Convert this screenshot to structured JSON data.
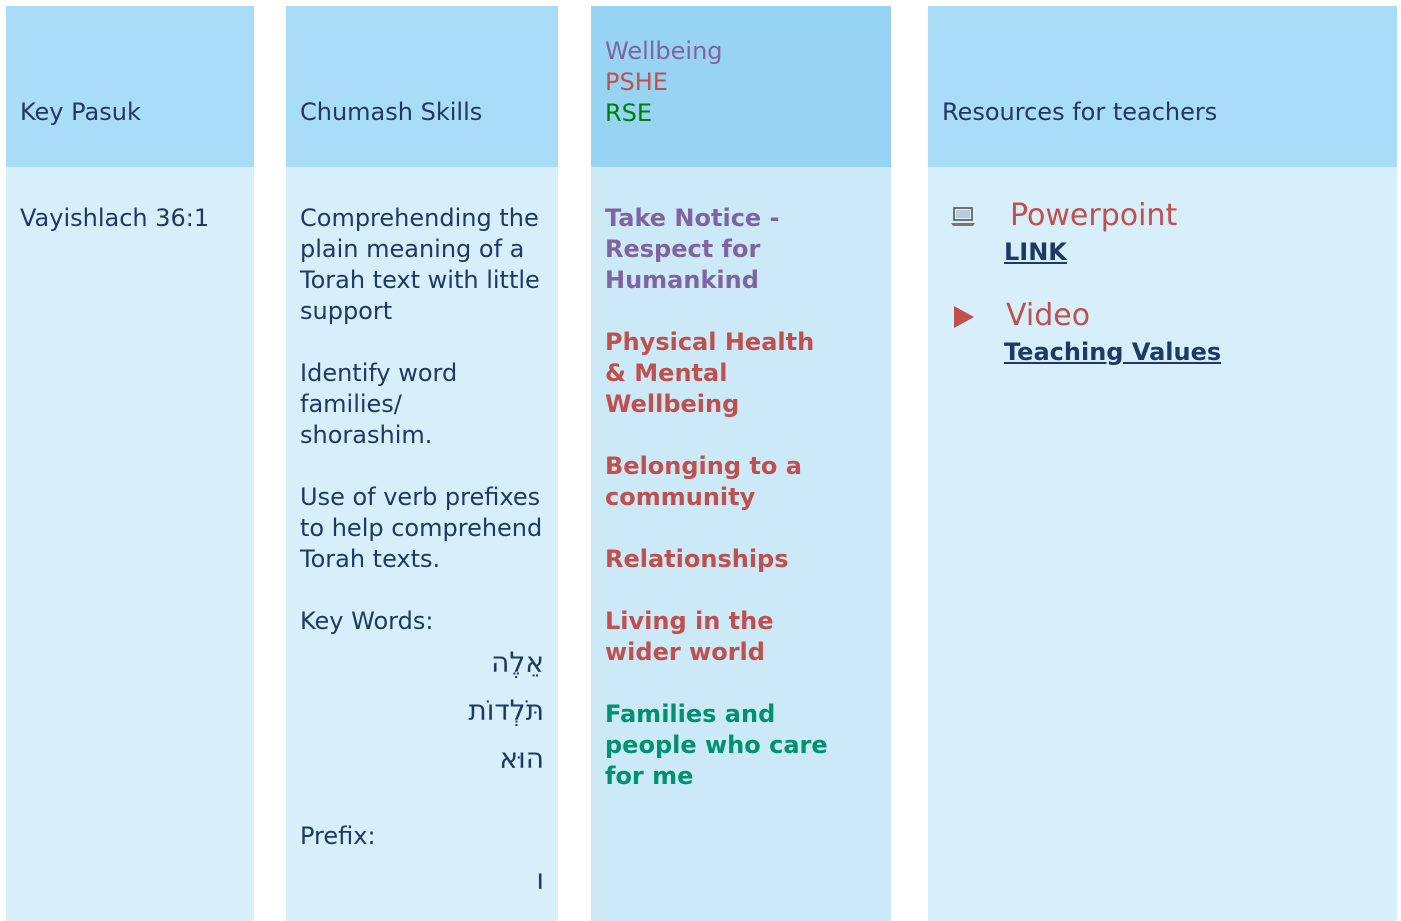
{
  "columns": {
    "key_pasuk": {
      "header": "Key Pasuk",
      "value": "Vayishlach 36:1"
    },
    "chumash_skills": {
      "header": "Chumash Skills",
      "paragraphs": [
        "Comprehending the plain meaning of a Torah text with little support",
        "Identify word families/ shorashim.",
        "Use of verb prefixes to help comprehend Torah texts."
      ],
      "key_words_label": "Key Words:",
      "key_words": [
        "אֵלֶה",
        "תֹּלְדוֹת",
        "הוּא"
      ],
      "prefix_label": "Prefix:",
      "prefix": "ו"
    },
    "wellbeing": {
      "header_lines": [
        "Wellbeing",
        "PSHE",
        "RSE"
      ],
      "items": [
        "Take Notice - Respect for Humankind",
        "Physical Health & Mental Wellbeing",
        "Belonging to a community",
        "Relationships",
        "Living in the wider world",
        "Families and people who care for me"
      ]
    },
    "resources": {
      "header": "Resources for teachers",
      "items": [
        {
          "icon": "laptop-icon",
          "title": "Powerpoint",
          "link": "LINK"
        },
        {
          "icon": "play-icon",
          "title": "Video",
          "link": "Teaching Values"
        }
      ]
    }
  },
  "colors": {
    "header_bg": "#a9dcf7",
    "body_bg": "#d7effb",
    "text": "#1f3864",
    "wellbeing": "#8064a2",
    "pshe": "#c0504d",
    "rse": "#008000",
    "families": "#00916e"
  }
}
